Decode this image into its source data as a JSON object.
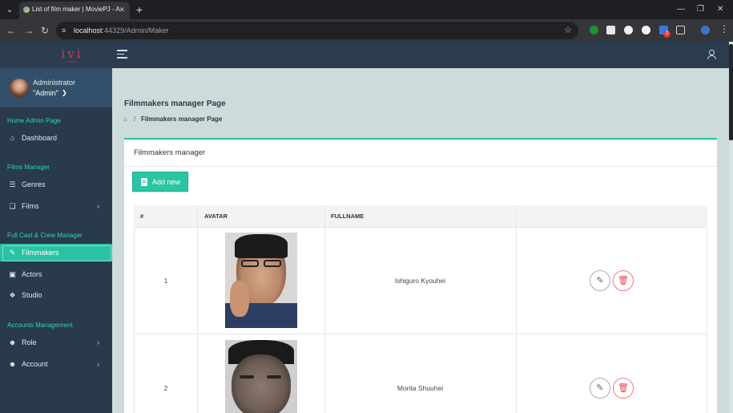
{
  "browser": {
    "tab_title": "List of film maker | MoviePJ - A",
    "url_host": "localhost",
    "url_path": ":44329/Admin/Maker",
    "extension_badge": "2"
  },
  "header": {
    "logo_text": "ivi",
    "logo_sub": "movie"
  },
  "sidebar": {
    "user_name": "Administrator",
    "user_role": "\"Admin\"",
    "sections": {
      "home": "Home Admin Page",
      "films": "Films Manager",
      "cast": "Full Cast & Crew Manager",
      "accounts": "Accounts Management"
    },
    "items": {
      "dashboard": "Dashboard",
      "genres": "Genres",
      "films": "Films",
      "filmmakers": "Filmmakers",
      "actors": "Actors",
      "studio": "Studio",
      "role": "Role",
      "account": "Account"
    }
  },
  "page": {
    "title": "Filmmakers manager Page",
    "breadcrumb_sep": "/",
    "breadcrumb_current": "Filmmakers manager Page",
    "card_title": "Filmmakers manager",
    "add_button": "Add new"
  },
  "table": {
    "columns": [
      "#",
      "AVATAR",
      "FULLNAME",
      ""
    ],
    "rows": [
      {
        "num": "1",
        "fullname": "Ishiguro Kyouhei"
      },
      {
        "num": "2",
        "fullname": "Morita Shuuhei"
      }
    ]
  },
  "icons": {
    "edit": "edit-icon",
    "delete": "trash-icon",
    "home": "home-icon",
    "add": "document-icon"
  },
  "colors": {
    "accent": "#2ac5a3",
    "sidebar": "#283a4b",
    "topbar": "#2b3d4f",
    "danger": "#e74c4c"
  }
}
